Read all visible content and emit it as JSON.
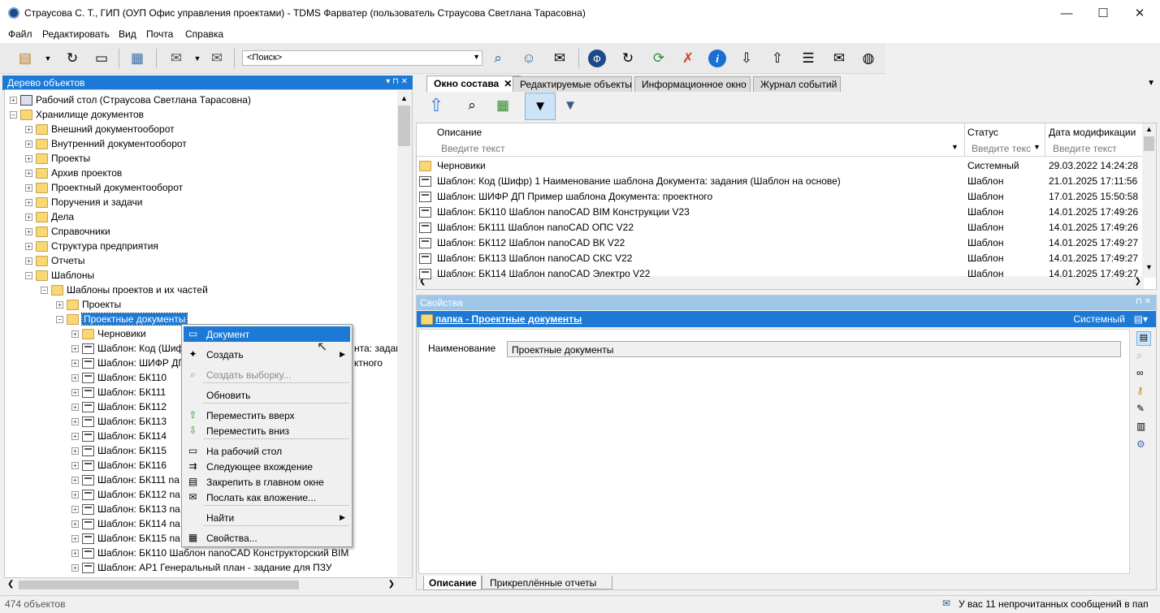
{
  "window": {
    "title": "Страусова С. Т., ГИП (ОУП Офис управления проектами) - TDMS Фарватер (пользователь Страусова Светлана Тарасовна)",
    "min": "—",
    "max": "☐",
    "close": "✕"
  },
  "menu": [
    "Файл",
    "Редактировать",
    "Вид",
    "Почта",
    "Справка"
  ],
  "toolbar": {
    "search_value": "<Поиск>",
    "icons": [
      "new-object-icon",
      "refresh-icon",
      "window-icon",
      "object-tree-icon",
      "mail-edit-icon",
      "send-mail-icon",
      "search-binoculars-icon",
      "user-search-icon",
      "mail-icon",
      "app-logo-icon",
      "reload-icon",
      "users-sync-icon",
      "users-remove-icon",
      "info-icon",
      "document-download-icon",
      "document-upload-icon",
      "message-icon",
      "mail-open-icon",
      "globe-icon"
    ]
  },
  "tree_panel": {
    "title": "Дерево объектов",
    "controls": "▾ ⊓ ✕",
    "nodes": [
      {
        "label": "Рабочий стол (Страусова Светлана Тарасовна)",
        "level": 0,
        "icon": "desk"
      },
      {
        "label": "Хранилище документов",
        "level": 0,
        "icon": "folder",
        "open": true
      },
      {
        "label": "Внешний документооборот",
        "level": 1,
        "icon": "folder"
      },
      {
        "label": "Внутренний документооборот",
        "level": 1,
        "icon": "folder"
      },
      {
        "label": "Проекты",
        "level": 1,
        "icon": "folder"
      },
      {
        "label": "Архив проектов",
        "level": 1,
        "icon": "folder"
      },
      {
        "label": "Проектный документооборот",
        "level": 1,
        "icon": "folder"
      },
      {
        "label": "Поручения и задачи",
        "level": 1,
        "icon": "folder"
      },
      {
        "label": "Дела",
        "level": 1,
        "icon": "folder"
      },
      {
        "label": "Справочники",
        "level": 1,
        "icon": "folder"
      },
      {
        "label": "Структура предприятия",
        "level": 1,
        "icon": "folder"
      },
      {
        "label": "Отчеты",
        "level": 1,
        "icon": "folder"
      },
      {
        "label": "Шаблоны",
        "level": 1,
        "icon": "folder",
        "open": true
      },
      {
        "label": "Шаблоны проектов и их частей",
        "level": 2,
        "icon": "folder",
        "open": true
      },
      {
        "label": "Проекты",
        "level": 3,
        "icon": "folder"
      },
      {
        "label": "Проектные документы",
        "level": 3,
        "icon": "folder",
        "open": true,
        "selected": true
      },
      {
        "label": "Черновики",
        "level": 4,
        "icon": "folder"
      },
      {
        "label": "Шаблон: Код (Шифр)",
        "level": 4,
        "icon": "doc",
        "tail": "нта: задан"
      },
      {
        "label": "Шаблон: ШИФР ДП",
        "level": 4,
        "icon": "doc",
        "tail": "ктного"
      },
      {
        "label": "Шаблон: БК110",
        "level": 4,
        "icon": "doc",
        "tail": ""
      },
      {
        "label": "Шаблон: БК111",
        "level": 4,
        "icon": "doc",
        "tail": ""
      },
      {
        "label": "Шаблон: БК112",
        "level": 4,
        "icon": "doc",
        "tail": ""
      },
      {
        "label": "Шаблон: БК113",
        "level": 4,
        "icon": "doc",
        "tail": ""
      },
      {
        "label": "Шаблон: БК114",
        "level": 4,
        "icon": "doc",
        "tail": ""
      },
      {
        "label": "Шаблон: БК115",
        "level": 4,
        "icon": "doc",
        "tail": ""
      },
      {
        "label": "Шаблон: БК116",
        "level": 4,
        "icon": "doc",
        "tail": ""
      },
      {
        "label": "Шаблон: БК111  na",
        "level": 4,
        "icon": "doc",
        "tail": ""
      },
      {
        "label": "Шаблон: БК112  na",
        "level": 4,
        "icon": "doc",
        "tail": ""
      },
      {
        "label": "Шаблон: БК113  na",
        "level": 4,
        "icon": "doc",
        "tail": ""
      },
      {
        "label": "Шаблон: БК114  na",
        "level": 4,
        "icon": "doc",
        "tail": ""
      },
      {
        "label": "Шаблон: БК115  na",
        "level": 4,
        "icon": "doc",
        "tail": ""
      },
      {
        "label": "Шаблон: БК110  Шаблон nanoCAD Конструкторский BIM",
        "level": 4,
        "icon": "doc",
        "tail": ""
      },
      {
        "label": "Шаблон: АР1  Генеральный план - задание для ПЗУ",
        "level": 4,
        "icon": "doc",
        "tail": ""
      }
    ]
  },
  "context_menu": [
    {
      "label": "Документ",
      "highlighted": true,
      "icon": "document-icon"
    },
    {
      "label": "Создать",
      "submenu": true,
      "icon": "create-icon"
    },
    {
      "label": "Создать выборку...",
      "disabled": true,
      "icon": "selection-icon"
    },
    {
      "label": "Обновить"
    },
    {
      "label": "Переместить вверх",
      "icon": "arrow-up-icon"
    },
    {
      "label": "Переместить вниз",
      "icon": "arrow-down-icon"
    },
    {
      "label": "На рабочий стол",
      "icon": "desktop-icon"
    },
    {
      "label": "Следующее вхождение",
      "icon": "next-entry-icon"
    },
    {
      "label": "Закрепить в главном окне",
      "icon": "pin-icon"
    },
    {
      "label": "Послать как вложение...",
      "icon": "send-attachment-icon"
    },
    {
      "label": "Найти",
      "submenu": true
    },
    {
      "label": "Свойства...",
      "icon": "properties-icon"
    }
  ],
  "tabs": [
    {
      "label": "Окно состава",
      "active": true,
      "close": "✕"
    },
    {
      "label": "Редактируемые объекты"
    },
    {
      "label": "Информационное окно"
    },
    {
      "label": "Журнал событий"
    }
  ],
  "grid": {
    "columns": [
      "Описание",
      "Статус",
      "Дата модификации"
    ],
    "filter_placeholders": [
      "Введите текст",
      "Введите текс",
      "Введите текст"
    ],
    "rows": [
      [
        "Черновики",
        "Системный",
        "29.03.2022 14:24:28"
      ],
      [
        "Шаблон: Код (Шифр) 1  Наименование шаблона Документа: задания (Шаблон на основе)",
        "Шаблон",
        "21.01.2025 17:11:56"
      ],
      [
        "Шаблон: ШИФР ДП  Пример шаблона Документа: проектного",
        "Шаблон",
        "17.01.2025 15:50:58"
      ],
      [
        "Шаблон: БК110  Шаблон nanoCAD BIM Конструкции V23",
        "Шаблон",
        "14.01.2025 17:49:26"
      ],
      [
        "Шаблон: БК111  Шаблон nanoCAD ОПС V22",
        "Шаблон",
        "14.01.2025 17:49:26"
      ],
      [
        "Шаблон: БК112  Шаблон nanoCAD ВК V22",
        "Шаблон",
        "14.01.2025 17:49:27"
      ],
      [
        "Шаблон: БК113  Шаблон nanoCAD СКС V22",
        "Шаблон",
        "14.01.2025 17:49:27"
      ],
      [
        "Шаблон: БК114  Шаблон nanoCAD Электро V22",
        "Шаблон",
        "14.01.2025 17:49:27"
      ]
    ]
  },
  "properties": {
    "title": "Свойства",
    "object_link": "папка - Проектные документы",
    "status": "Системный",
    "field_label": "Наименование",
    "field_value": "Проектные документы",
    "tabs": [
      "Описание",
      "Прикреплённые отчеты"
    ]
  },
  "status": {
    "count": "474 объектов",
    "messages": "У вас 11 непрочитанных сообщений в пап"
  }
}
